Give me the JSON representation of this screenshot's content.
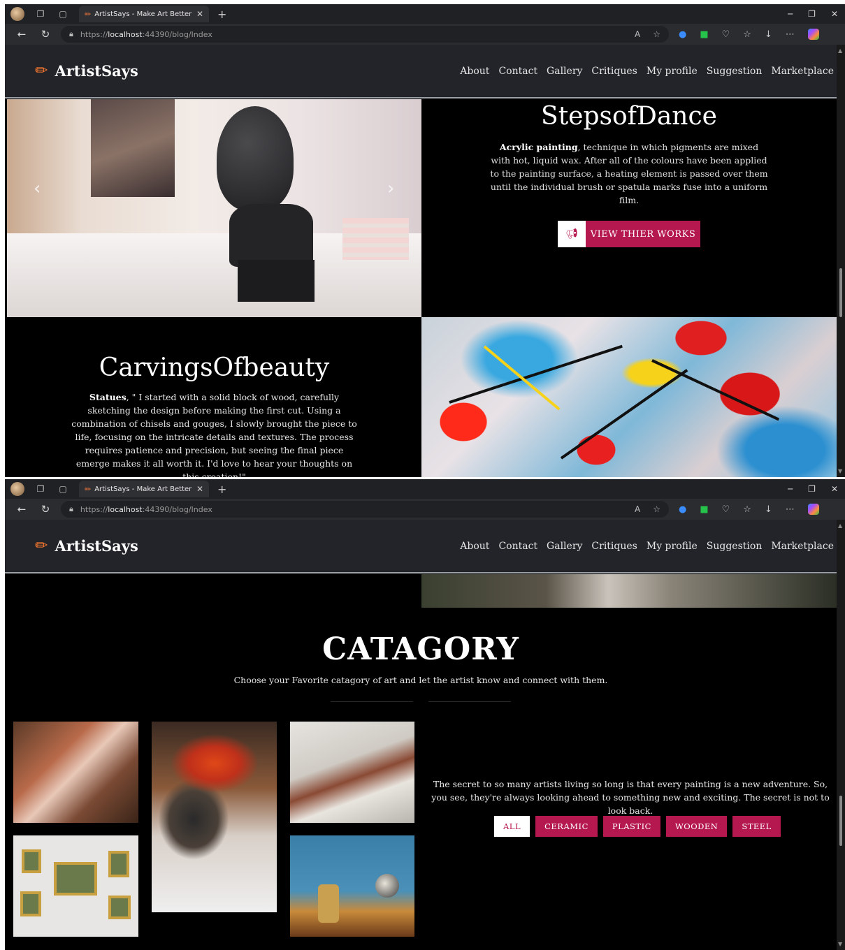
{
  "browser": {
    "tab_title": "ArtistSays - Make Art Better",
    "tab_favicon": "✏",
    "url_scheme": "https://",
    "url_host": "localhost",
    "url_rest": ":44390/blog/Index"
  },
  "site": {
    "brand": "ArtistSays",
    "nav": [
      "About",
      "Contact",
      "Gallery",
      "Critiques",
      "My profile",
      "Suggestion",
      "Marketplace"
    ],
    "accent_color": "#b5184f"
  },
  "feature_dance": {
    "title": "StepsofDance",
    "desc_bold": "Acrylic painting",
    "desc": ", technique in which pigments are mixed with hot, liquid wax. After all of the colours have been applied to the painting surface, a heating element is passed over them until the individual brush or spatula marks fuse into a uniform film.",
    "button_label": "VIEW THIER WORKS"
  },
  "feature_carving": {
    "title": "CarvingsOfbeauty",
    "desc_bold": "Statues",
    "desc": ", \" I started with a solid block of wood, carefully sketching the design before making the first cut. Using a combination of chisels and gouges, I slowly brought the piece to life, focusing on the intricate details and textures. The process requires patience and precision, but seeing the final piece emerge makes it all worth it. I'd love to hear your thoughts on this creation!\""
  },
  "category": {
    "title": "CATAGORY",
    "subtitle": "Choose your Favorite catagory of art and let the artist know and connect with them.",
    "quote": "The secret to so many artists living so long is that every painting is a new adventure. So, you see, they're always looking ahead to something new and exciting. The secret is not to look back.",
    "filters": [
      "ALL",
      "CERAMIC",
      "PLASTIC",
      "WOODEN",
      "STEEL"
    ]
  }
}
